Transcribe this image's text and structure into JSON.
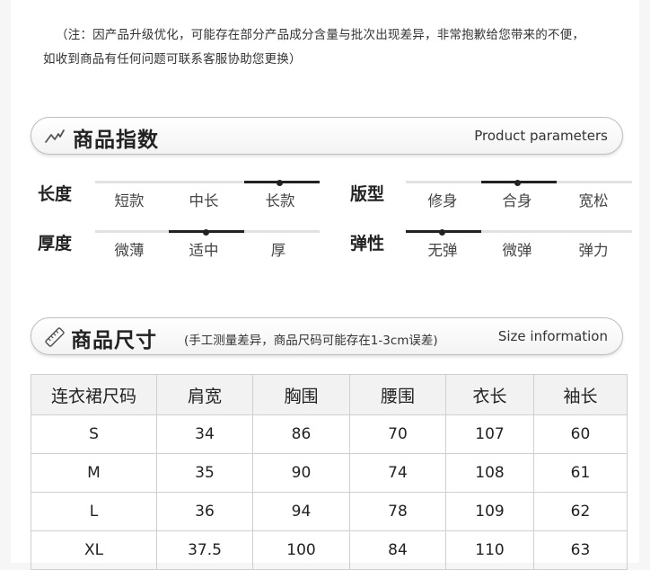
{
  "notice": {
    "line1": "（注：因产品升级优化，可能存在部分产品成分含量与批次出现差异，非常抱歉给您带来的不便，",
    "line2": "如收到商品有任何问题可联系客服协助您更换）"
  },
  "product_index": {
    "title": "商品指数",
    "en": "Product parameters",
    "icon": "trend-line-icon",
    "attributes": [
      {
        "label": "长度",
        "options": [
          "短款",
          "中长",
          "长款"
        ],
        "selected": "长款"
      },
      {
        "label": "版型",
        "options": [
          "修身",
          "合身",
          "宽松"
        ],
        "selected": "合身"
      },
      {
        "label": "厚度",
        "options": [
          "微薄",
          "适中",
          "厚"
        ],
        "selected": "适中"
      },
      {
        "label": "弹性",
        "options": [
          "无弹",
          "微弹",
          "弹力"
        ],
        "selected": "无弹"
      }
    ]
  },
  "size_info": {
    "title": "商品尺寸",
    "note": "(手工测量差异，商品尺码可能存在1-3cm误差)",
    "en": "Size information",
    "icon": "ruler-icon",
    "columns": [
      "连衣裙尺码",
      "肩宽",
      "胸围",
      "腰围",
      "衣长",
      "袖长"
    ],
    "rows": [
      [
        "S",
        "34",
        "86",
        "70",
        "107",
        "60"
      ],
      [
        "M",
        "35",
        "90",
        "74",
        "108",
        "61"
      ],
      [
        "L",
        "36",
        "94",
        "78",
        "109",
        "62"
      ],
      [
        "XL",
        "37.5",
        "100",
        "84",
        "110",
        "63"
      ]
    ]
  },
  "colors": {
    "track_selected": "#222222",
    "track_base": "#e2e2e2",
    "header_bg": "#f2f2f2"
  }
}
